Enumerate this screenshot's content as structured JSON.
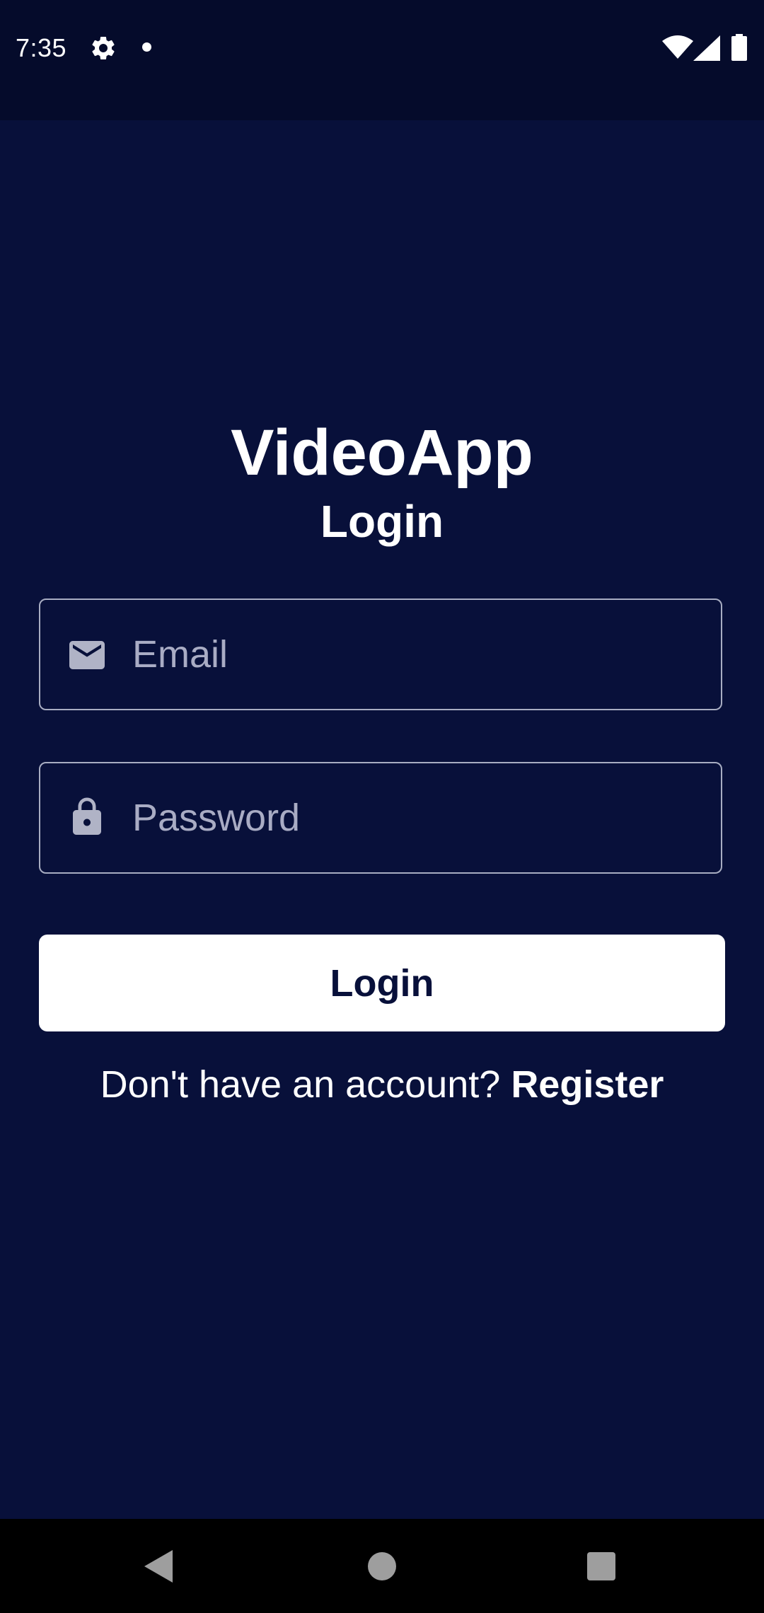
{
  "status_bar": {
    "time": "7:35",
    "icons": [
      "gear-icon",
      "notification-dot-icon",
      "wifi-icon",
      "cell-signal-icon",
      "battery-icon"
    ]
  },
  "header": {
    "app_title": "VideoApp",
    "page_title": "Login"
  },
  "form": {
    "email": {
      "placeholder": "Email",
      "value": "",
      "icon": "mail-icon"
    },
    "password": {
      "placeholder": "Password",
      "value": "",
      "icon": "lock-icon"
    },
    "login_button_label": "Login"
  },
  "register": {
    "prompt": "Don't have an account? ",
    "link_label": "Register"
  },
  "nav_bar": {
    "icons": [
      "back-icon",
      "home-icon",
      "recents-icon"
    ]
  },
  "colors": {
    "background": "#08103a",
    "status_bar": "#050b2b",
    "primary_text": "#ffffff",
    "field_border": "#a8adc2",
    "button_background": "#ffffff",
    "button_text": "#08103a"
  }
}
